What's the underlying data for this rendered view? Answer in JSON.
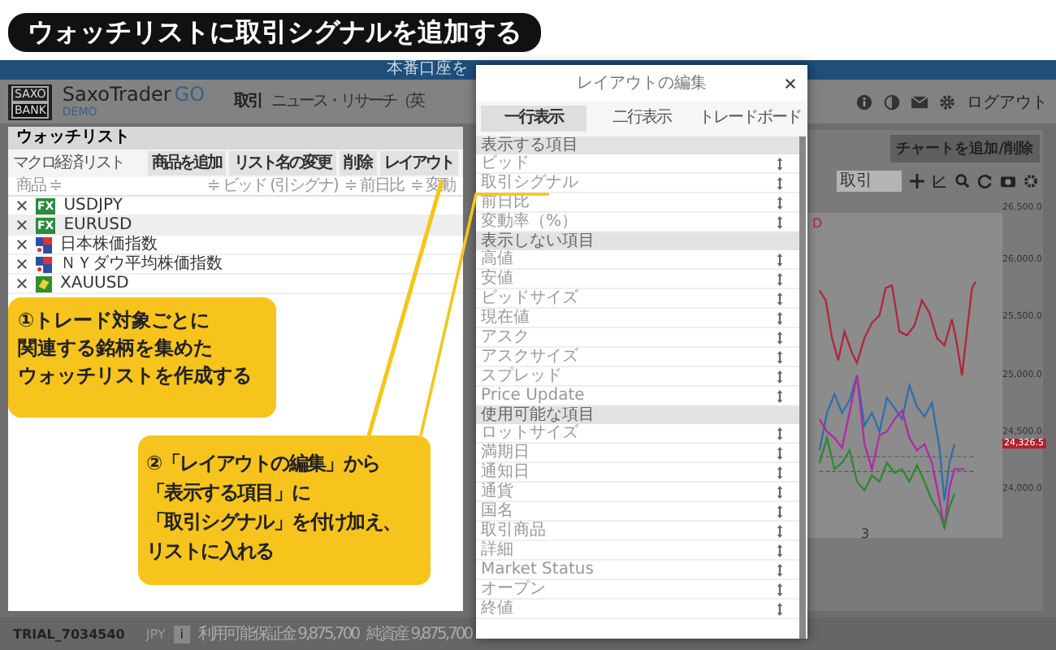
{
  "banner": {
    "title": "ウォッチリストに取引シグナルを追加する"
  },
  "notice_bar": {
    "text": "本番口座を"
  },
  "header": {
    "logo_top": "SAXO",
    "logo_bottom": "BANK",
    "app_name": "SaxoTrader",
    "app_suffix": "GO",
    "badge": "DEMO",
    "nav": [
      {
        "label": "取引",
        "selected": true
      },
      {
        "label": "ニュース・リサーチ（英",
        "selected": false
      }
    ],
    "logout": "ログアウト"
  },
  "watchlist": {
    "title": "ウォッチリスト",
    "list_name": "マクロ経済リスト",
    "buttons": [
      "商品を追加",
      "リスト名の変更",
      "削除",
      "レイアウト"
    ],
    "columns": [
      "商品 ≑",
      "≑ ビッド (引シグナ)",
      "≑ 前日比",
      "≑ 変動"
    ],
    "rows": [
      {
        "kind": "fx",
        "badge": "FX",
        "name": "USDJPY",
        "selected": false
      },
      {
        "kind": "fx",
        "badge": "FX",
        "name": "EURUSD",
        "selected": true
      },
      {
        "kind": "index",
        "name": "日本株価指数",
        "selected": false
      },
      {
        "kind": "index",
        "name": "ＮＹダウ平均株価指数",
        "selected": false
      },
      {
        "kind": "commodity",
        "name": "XAUUSD",
        "selected": false
      }
    ]
  },
  "chart_panel": {
    "button": "チャートを追加/削除",
    "search": {
      "placeholder": "取引"
    },
    "legend": "D",
    "yticks": [
      "26,500.0",
      "26,000.0",
      "25,500.0",
      "25,000.0",
      "24,500.0",
      "24,000.0"
    ],
    "price_tag": "24,326.5",
    "x_label": "3"
  },
  "layout_dialog": {
    "title": "レイアウトの編集",
    "tabs": [
      {
        "label": "一行表示",
        "selected": true
      },
      {
        "label": "二行表示",
        "selected": false
      },
      {
        "label": "トレードボード",
        "selected": false
      }
    ],
    "sections": [
      {
        "title": "表示する項目",
        "items": [
          "ビッド",
          "取引シグナル",
          "前日比",
          "変動率（%）"
        ]
      },
      {
        "title": "表示しない項目",
        "items": [
          "高値",
          "安値",
          "ビッドサイズ",
          "現在値",
          "アスク",
          "アスクサイズ",
          "スプレッド",
          "Price Update"
        ]
      },
      {
        "title": "使用可能な項目",
        "items": [
          "ロットサイズ",
          "満期日",
          "通知日",
          "通貨",
          "国名",
          "取引商品",
          "詳細",
          "Market Status",
          "オープン",
          "終値"
        ]
      }
    ]
  },
  "callouts": [
    {
      "lines": [
        "①トレード対象ごとに",
        "関連する銘柄を集めた",
        "ウォッチリストを作成する"
      ]
    },
    {
      "lines": [
        "②「レイアウトの編集」から",
        "「表示する項目」に",
        "「取引シグナル」を付け加え、",
        "リストに入れる"
      ]
    }
  ],
  "status_bar": {
    "account": "TRIAL_7034540",
    "currency": "JPY",
    "info": "i",
    "available_margin": "利用可能保証金 9,875,700",
    "net_assets": "純資産 9,875,700"
  }
}
